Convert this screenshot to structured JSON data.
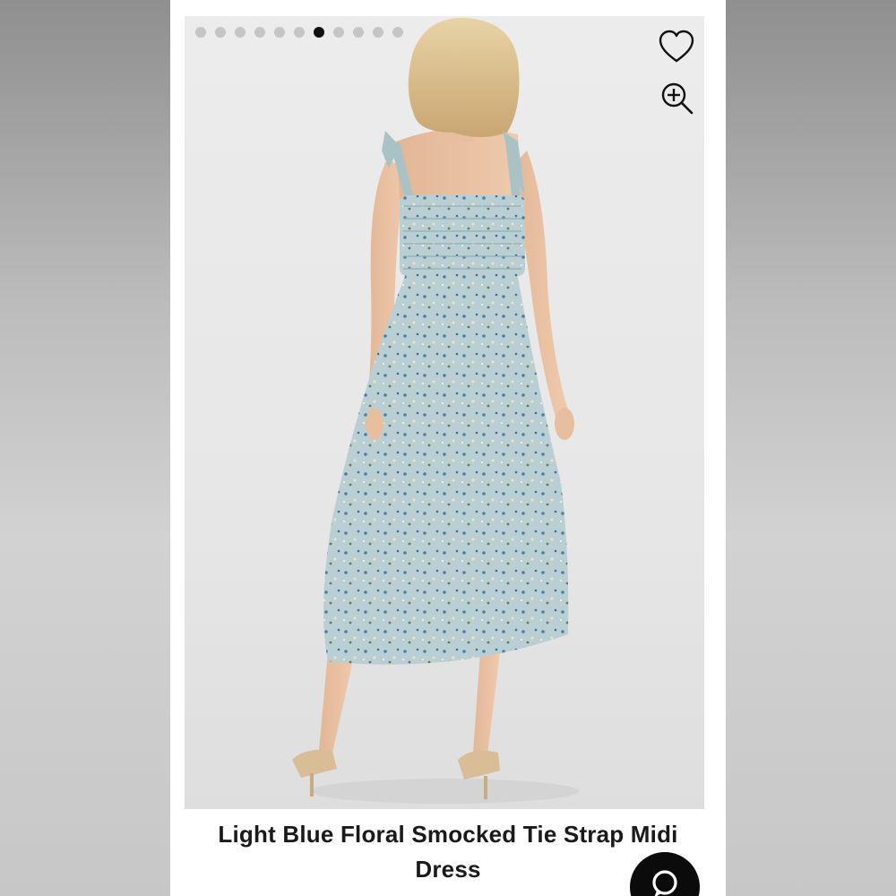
{
  "carousel": {
    "total_slides": 11,
    "active_index": 6
  },
  "product": {
    "title": "Light Blue Floral Smocked Tie Strap Midi Dress",
    "image_description_icon": "product-photo"
  },
  "actions": {
    "favorite_icon": "heart-outline-icon",
    "zoom_icon": "zoom-in-icon",
    "chat_icon": "chat-bubble-icon"
  },
  "colors": {
    "dress": "#b9cfd3",
    "dot_active": "#111111",
    "dot_inactive": "#c5c5c5",
    "fab": "#0b0b0b"
  }
}
